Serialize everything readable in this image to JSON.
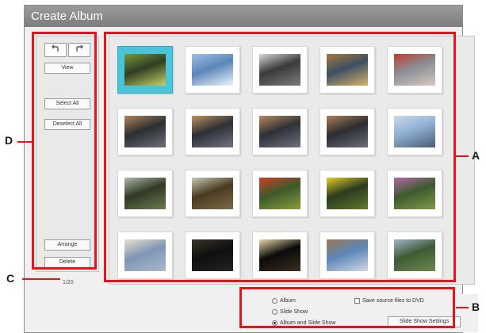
{
  "window": {
    "title": "Create Album"
  },
  "sidebar": {
    "rotate_left_icon": "rotate-left-icon",
    "rotate_right_icon": "rotate-right-icon",
    "view_label": "View",
    "select_all_label": "Select All",
    "deselect_all_label": "Deselect All",
    "arrange_label": "Arrange",
    "delete_label": "Delete"
  },
  "status": {
    "count": "1/20"
  },
  "thumbnails": [
    {
      "id": "1",
      "colors": [
        "#2f3d22",
        "#7a9a3a",
        "#c7d36a"
      ],
      "selected": true
    },
    {
      "id": "2",
      "colors": [
        "#5b86b9",
        "#9fc1e4",
        "#eef5fb"
      ]
    },
    {
      "id": "3",
      "colors": [
        "#3a3a3a",
        "#d7d7d7",
        "#7c7c7c"
      ]
    },
    {
      "id": "4",
      "colors": [
        "#3d4f63",
        "#a47a3c",
        "#d5b36b"
      ]
    },
    {
      "id": "5",
      "colors": [
        "#8a8f96",
        "#c23b2f",
        "#d7c8bd"
      ]
    },
    {
      "id": "6",
      "colors": [
        "#2c2e33",
        "#b1845a",
        "#6b6f78"
      ]
    },
    {
      "id": "7",
      "colors": [
        "#2d3035",
        "#bf9162",
        "#707480"
      ]
    },
    {
      "id": "8",
      "colors": [
        "#2e3136",
        "#b8895d",
        "#6d727c"
      ]
    },
    {
      "id": "9",
      "colors": [
        "#2b2d32",
        "#ae7f52",
        "#6a6e77"
      ]
    },
    {
      "id": "10",
      "colors": [
        "#8fb0d4",
        "#c9d9ec",
        "#4a5d74"
      ]
    },
    {
      "id": "11",
      "colors": [
        "#2f3a25",
        "#b3b7ab",
        "#6c7a4f"
      ]
    },
    {
      "id": "12",
      "colors": [
        "#4a3a23",
        "#c8c9b4",
        "#7b6a44"
      ]
    },
    {
      "id": "13",
      "colors": [
        "#3b5a2a",
        "#d23c2a",
        "#8a9b3c"
      ]
    },
    {
      "id": "14",
      "colors": [
        "#2c3a1e",
        "#e2d22a",
        "#5f7a2e"
      ]
    },
    {
      "id": "15",
      "colors": [
        "#3c5a2e",
        "#b36aa5",
        "#7f9a4a"
      ]
    },
    {
      "id": "16",
      "colors": [
        "#7f95b5",
        "#e8e2c9",
        "#a9b8cc"
      ]
    },
    {
      "id": "17",
      "colors": [
        "#0f0f12",
        "#3c3326",
        "#22221f"
      ]
    },
    {
      "id": "18",
      "colors": [
        "#0b0a09",
        "#e8d7a8",
        "#3a2e21"
      ]
    },
    {
      "id": "19",
      "colors": [
        "#5c86b7",
        "#9c7a52",
        "#cfd9e6"
      ]
    },
    {
      "id": "20",
      "colors": [
        "#3e5a34",
        "#9fb5c8",
        "#6d8a52"
      ]
    }
  ],
  "options": {
    "album_label": "Album",
    "slideshow_label": "Slide Show",
    "album_and_slideshow_label": "Album and Slide Show",
    "selected_option": "album_and_slideshow",
    "save_source_label": "Save source files to DVD",
    "save_source_checked": false,
    "slideshow_settings_label": "Slide Show Settings"
  },
  "callouts": {
    "a": "A",
    "b": "B",
    "c": "C",
    "d": "D"
  },
  "colors": {
    "callout_red": "#e8141c",
    "selection_blue": "#4bc3d8",
    "titlebar_gray": "#8a8a8a"
  }
}
